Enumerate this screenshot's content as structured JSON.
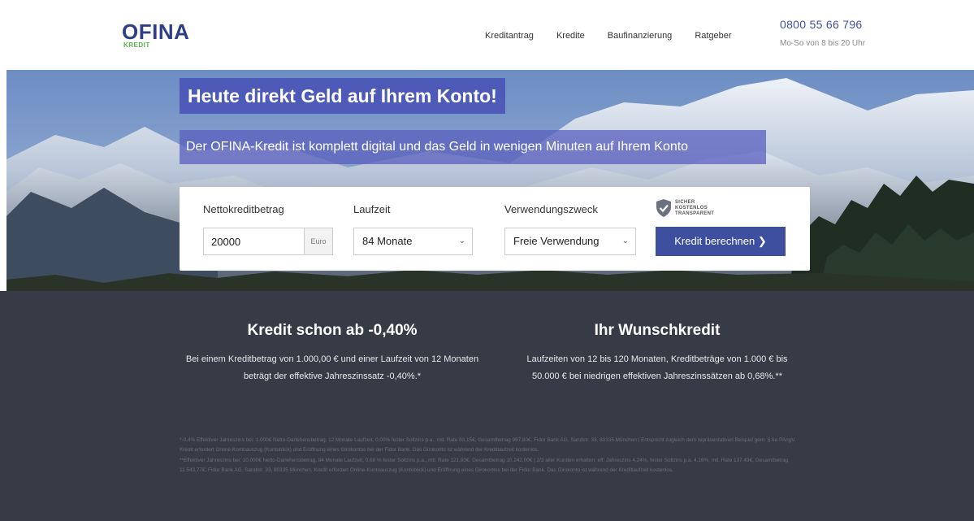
{
  "brand": {
    "name": "OFINA",
    "sub": "KREDIT"
  },
  "nav": [
    "Kreditantrag",
    "Kredite",
    "Baufinanzierung",
    "Ratgeber"
  ],
  "contact": {
    "phone": "0800 55 66 796",
    "hours": "Mo-So von 8 bis 20 Uhr"
  },
  "hero": {
    "headline": "Heute direkt Geld auf Ihrem Konto!",
    "subline": "Der OFINA-Kredit ist komplett digital und das Geld in wenigen Minuten auf Ihrem Konto"
  },
  "form": {
    "amount_label": "Nettokreditbetrag",
    "amount_value": "20000",
    "amount_unit": "Euro",
    "term_label": "Laufzeit",
    "term_value": "84 Monate",
    "purpose_label": "Verwendungszweck",
    "purpose_value": "Freie Verwendung",
    "badge_lines": [
      "SICHER",
      "KOSTENLOS",
      "TRANSPARENT"
    ],
    "submit_label": "Kredit berechnen ❯"
  },
  "info": {
    "left_title": "Kredit schon ab -0,40%",
    "left_text": "Bei einem Kreditbetrag von 1.000,00 € und einer Laufzeit von 12 Monaten beträgt der effektive Jahreszinssatz -0,40%.*",
    "right_title": "Ihr Wunschkredit",
    "right_text": "Laufzeiten von 12 bis 120 Monaten, Kreditbeträge von 1.000 € bis 50.000 € bei niedrigen effektiven Jahreszinssätzen ab 0,68%.**"
  },
  "fineprint": [
    "*-0,4% Effektiver Jahreszins bei: 1.000€ Netto-Darlehensbetrag, 12 Monate Laufzeit, 0,00% fester Sollzins p.a., mtl. Rate 83,15€, Gesamtbetrag 997,80€, Fidor Bank AG, Sandstr. 33, 80335 München | Entspricht zugleich dem repräsentativen Beispiel gem. § 6a PAngV. Kredit erfordert Online-Kontoauszug (Kontoblick) und Eröffnung eines Girokontos bei der Fidor Bank. Das Girokonto ist während der Kreditlaufzeit kostenlos.",
    "**Effektiver Jahreszins bei: 10.000€ Netto-Darlehensbetrag, 84 Monate Laufzeit, 0,68 % fester Sollzins p.a., mtl. Rate 121,93€, Gesamtbetrag 10.242,00€ | 2/3 aller Kunden erhalten: eff. Jahreszins 4,24%, fester Sollzins p.a. 4,16%, mtl. Rate 137,43€, Gesamtbetrag 11.543,77€, Fidor Bank AG, Sandstr. 33, 80335 München. Kredit erfordert Online-Kontoauszug (Kontoblick) und Eröffnung eines Girokontos bei der Fidor Bank. Das Girokonto ist während der Kreditlaufzeit kostenlos."
  ],
  "colors": {
    "brand_blue": "#3f4fa0",
    "brand_green": "#55b34a",
    "dark_bg": "#363b45"
  }
}
